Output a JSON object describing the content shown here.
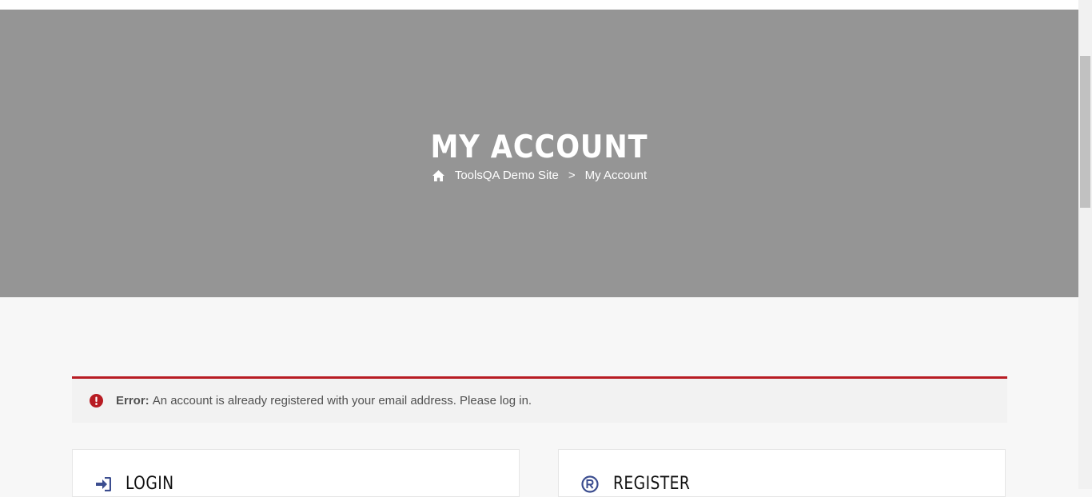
{
  "hero": {
    "title": "MY ACCOUNT",
    "breadcrumb": {
      "home_label": "ToolsQA Demo Site",
      "separator": ">",
      "current": "My Account"
    }
  },
  "notice": {
    "type": "error",
    "label": "Error:",
    "message": "An account is already registered with your email address. Please log in."
  },
  "panels": {
    "login": {
      "title": "LOGIN",
      "icon": "sign-in-icon"
    },
    "register": {
      "title": "REGISTER",
      "icon": "registered-icon"
    }
  },
  "colors": {
    "hero_bg": "#959595",
    "error_accent": "#b81c23",
    "icon_blue": "#3b4d8f"
  }
}
